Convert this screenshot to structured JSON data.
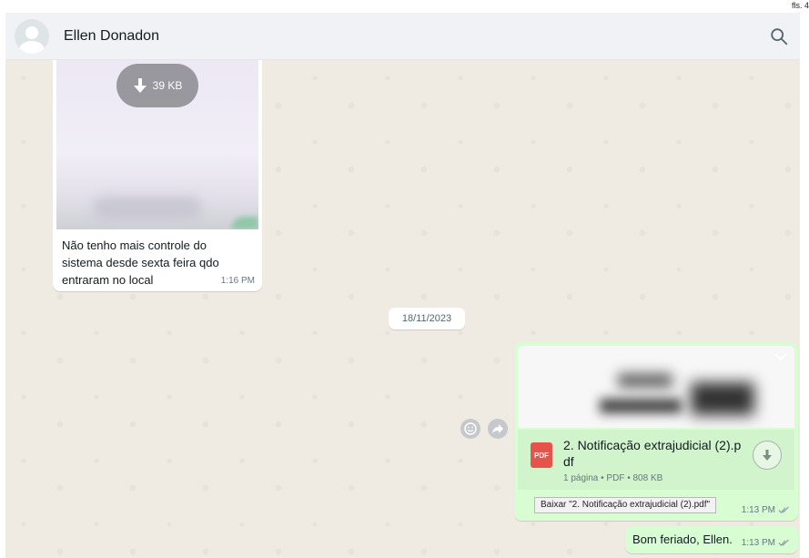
{
  "page_corner": "fls. 4",
  "header": {
    "contact_name": "Ellen Donadon"
  },
  "incoming_message": {
    "download_size": "39 KB",
    "text": "Não tenho mais controle do sistema desde sexta feira qdo entraram no local",
    "time": "1:16 PM"
  },
  "date_separator": "18/11/2023",
  "outgoing_document": {
    "file_name": "2. Notificação extrajudicial (2).pdf",
    "file_name_display": "2. Notificação extrajudicial (2).p df",
    "pdf_badge": "PDF",
    "meta": "1 página • PDF • 808 KB",
    "tooltip": "Baixar \"2. Notificação extrajudicial (2).pdf\"",
    "time": "1:13 PM"
  },
  "outgoing_message": {
    "text": "Bom feriado, Ellen.",
    "time": "1:13 PM"
  },
  "colors": {
    "header_bg": "#f0f2f5",
    "chat_bg": "#efeae2",
    "outgoing_bubble": "#d9fdd3",
    "incoming_bubble": "#ffffff",
    "pdf_red": "#e5534b"
  },
  "icons": [
    "search-icon",
    "download-arrow-icon",
    "chevron-down-icon",
    "pdf-icon",
    "download-circle-icon",
    "emoji-icon",
    "forward-icon",
    "double-check-icon",
    "avatar-icon"
  ]
}
